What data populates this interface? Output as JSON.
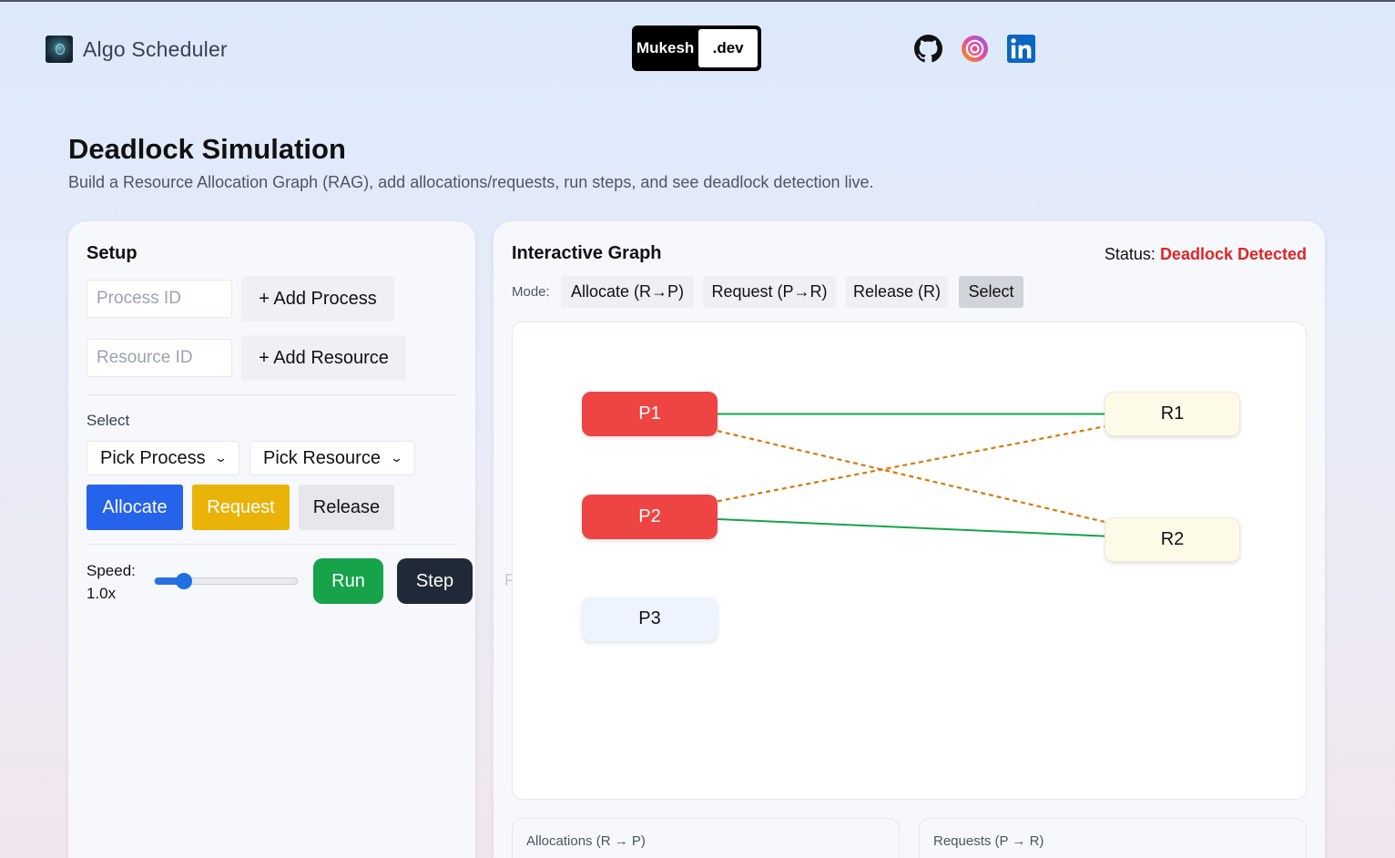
{
  "header": {
    "app_name": "Algo Scheduler",
    "badge_left": "Mukesh",
    "badge_right": ".dev",
    "social_icons": [
      "github-icon",
      "instagram-icon",
      "linkedin-icon"
    ]
  },
  "page": {
    "title": "Deadlock Simulation",
    "subtitle": "Build a Resource Allocation Graph (RAG), add allocations/requests, run steps, and see deadlock detection live."
  },
  "setup": {
    "title": "Setup",
    "process_input_placeholder": "Process ID",
    "add_process_label": "+ Add Process",
    "resource_input_placeholder": "Resource ID",
    "add_resource_label": "+ Add Resource",
    "select_label": "Select",
    "process_select_value": "Pick Process",
    "resource_select_value": "Pick Resource",
    "allocate_label": "Allocate",
    "request_label": "Request",
    "release_label": "Release",
    "speed_label": "Speed:",
    "speed_value": "1.0x",
    "speed_fraction": 0.2,
    "run_label": "Run",
    "step_label": "Step"
  },
  "graph": {
    "title": "Interactive Graph",
    "status_label": "Status:",
    "status_value": "Deadlock Detected",
    "mode_label": "Mode:",
    "modes": [
      {
        "label": "Allocate (R→P)",
        "active": false
      },
      {
        "label": "Request (P→R)",
        "active": false
      },
      {
        "label": "Release (R)",
        "active": false
      },
      {
        "label": "Select",
        "active": true
      }
    ],
    "processes": [
      {
        "id": "P1",
        "deadlocked": true
      },
      {
        "id": "P2",
        "deadlocked": true
      },
      {
        "id": "P3",
        "deadlocked": false
      }
    ],
    "resources": [
      {
        "id": "R1"
      },
      {
        "id": "R2"
      }
    ],
    "allocations": [
      {
        "from": "R1",
        "to": "P1"
      },
      {
        "from": "R2",
        "to": "P2"
      }
    ],
    "requests": [
      {
        "from": "P1",
        "to": "R2"
      },
      {
        "from": "P2",
        "to": "R1"
      }
    ],
    "colors": {
      "allocation_edge": "#16a34a",
      "request_edge": "#d97706",
      "deadlocked_process": "#ef4444"
    },
    "ghost_text": "F",
    "allocations_panel_title": "Allocations (R → P)",
    "requests_panel_title": "Requests (P → R)"
  }
}
